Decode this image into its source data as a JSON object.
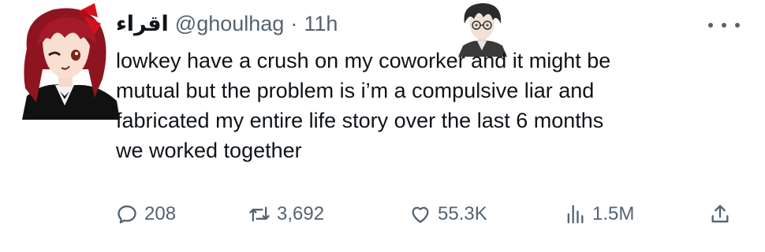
{
  "author": {
    "display_name": "اقراء",
    "handle": "@ghoulhag",
    "separator": "·",
    "time": "11h",
    "avatar_icon": "anime-girl-avatar",
    "sticker_icon": "anime-boy-sticker"
  },
  "tweet": {
    "lines": [
      "lowkey have a crush on my coworker and it might be",
      "mutual but the problem is i’m a compulsive liar and",
      "fabricated my entire life story over the last 6 months",
      "we worked together"
    ]
  },
  "actions": {
    "replies": "208",
    "retweets": "3,692",
    "likes": "55.3K",
    "views": "1.5M"
  },
  "colors": {
    "text": "#0f1419",
    "muted": "#536471",
    "background": "#ffffff"
  }
}
